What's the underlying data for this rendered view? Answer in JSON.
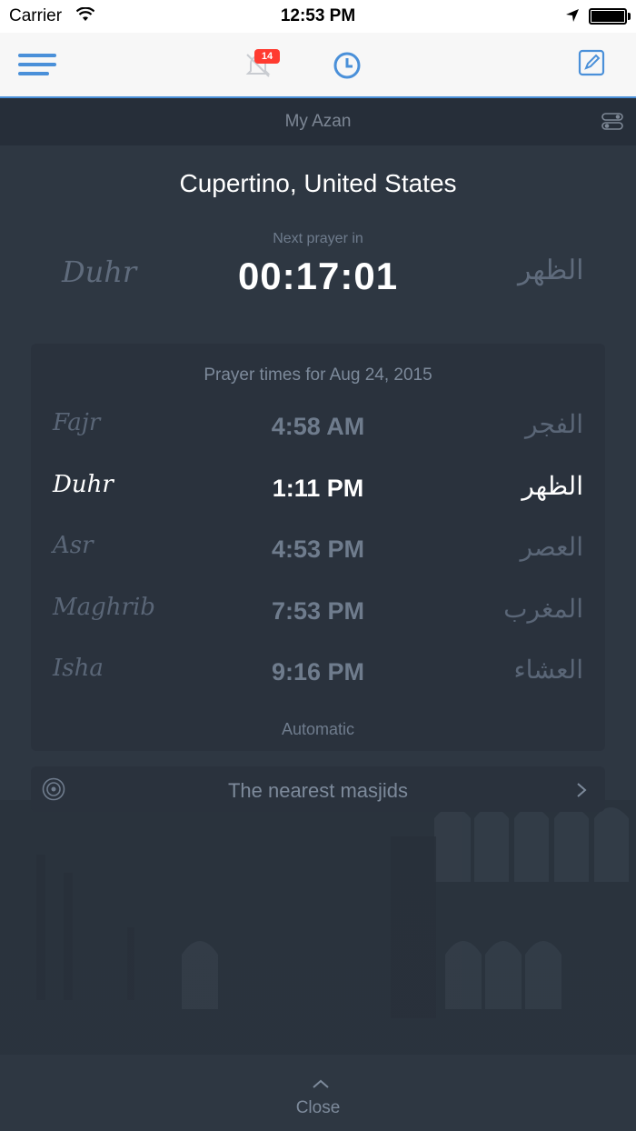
{
  "status_bar": {
    "carrier": "Carrier",
    "time": "12:53 PM"
  },
  "nav": {
    "notification_count": "14",
    "accent": "#4a90d9",
    "icons": [
      "menu-icon",
      "bell-muted-icon",
      "clock-icon",
      "compose-icon"
    ]
  },
  "subheader": {
    "title": "My Azan"
  },
  "location": {
    "city": "Cupertino, United States"
  },
  "next_prayer": {
    "label": "Next prayer in",
    "countdown": "00:17:01",
    "name_en": "Duhr",
    "name_ar": "الظهر"
  },
  "prayer_card": {
    "title": "Prayer times for Aug 24, 2015",
    "mode": "Automatic",
    "prayers": [
      {
        "en": "Fajr",
        "ar": "الفجر",
        "time": "4:58 AM",
        "active": false
      },
      {
        "en": "Duhr",
        "ar": "الظهر",
        "time": "1:11 PM",
        "active": true
      },
      {
        "en": "Asr",
        "ar": "العصر",
        "time": "4:53 PM",
        "active": false
      },
      {
        "en": "Maghrib",
        "ar": "المغرب",
        "time": "7:53 PM",
        "active": false
      },
      {
        "en": "Isha",
        "ar": "العشاء",
        "time": "9:16 PM",
        "active": false
      }
    ]
  },
  "masjids": {
    "label": "The nearest masjids"
  },
  "footer": {
    "close_label": "Close"
  }
}
